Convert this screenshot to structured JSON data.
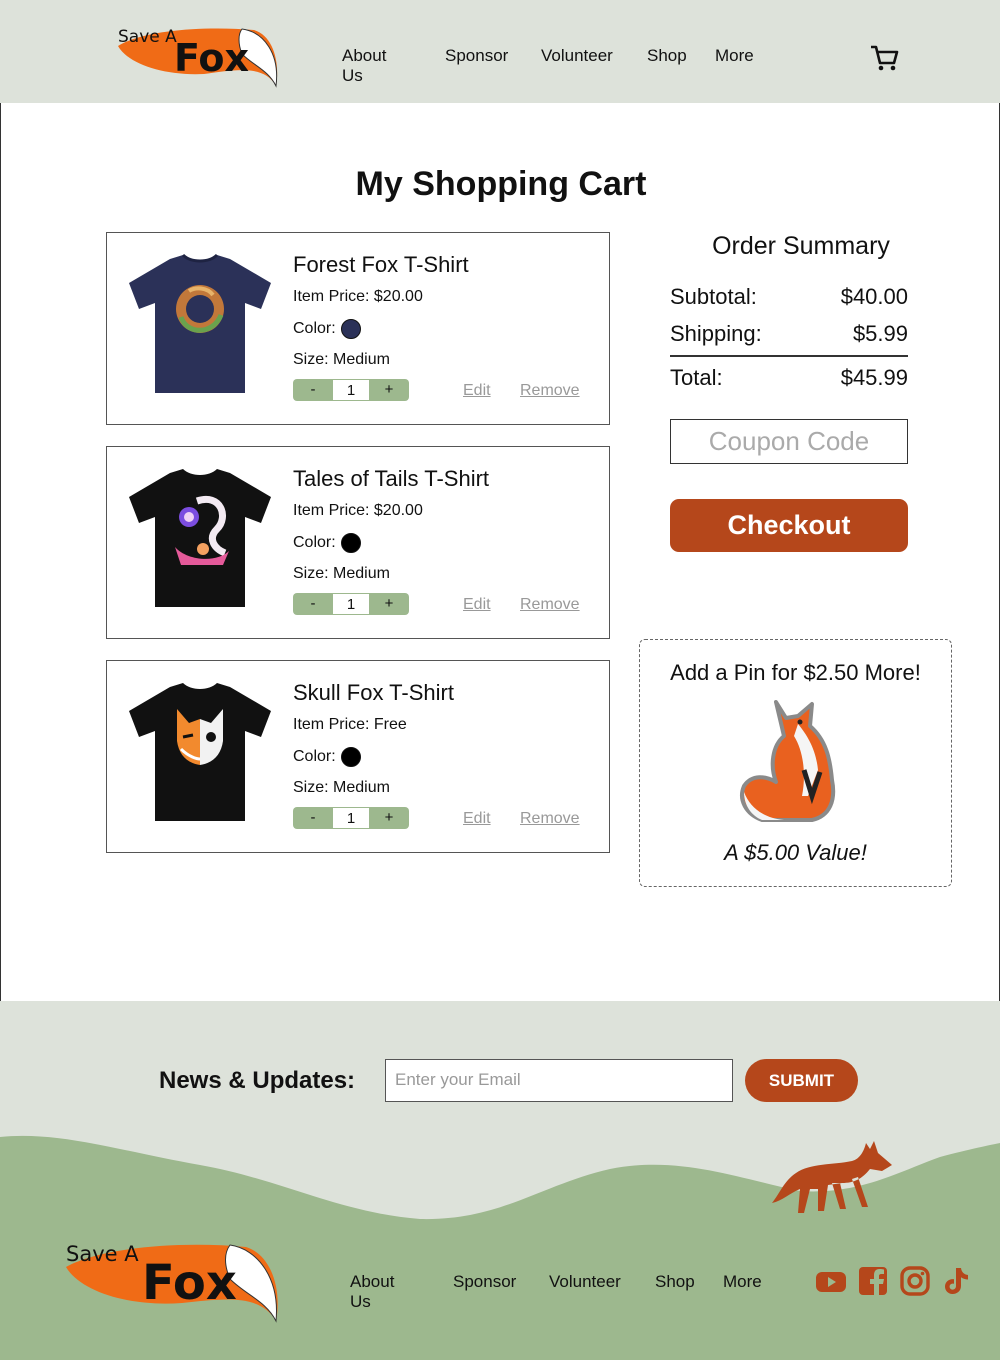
{
  "brand": {
    "logo_top": "Save A",
    "logo_main": "Fox",
    "colors": {
      "orange": "#f06b16",
      "rust": "#b5471b",
      "sage": "#9db88e",
      "mist": "#dde2da"
    }
  },
  "header": {
    "nav": [
      "About Us",
      "Sponsor",
      "Volunteer",
      "Shop",
      "More"
    ],
    "cart_icon": "shopping-cart-icon"
  },
  "page": {
    "title": "My Shopping Cart"
  },
  "cart": {
    "items": [
      {
        "name": "Forest Fox T-Shirt",
        "price": "Item Price: $20.00",
        "color_label": "Color:",
        "color": "#2b3158",
        "size": "Size: Medium",
        "quantity": "1",
        "minus": "-",
        "plus": "+",
        "edit": "Edit",
        "remove": "Remove"
      },
      {
        "name": "Tales of Tails T-Shirt",
        "price": "Item Price: $20.00",
        "color_label": "Color:",
        "color": "#000000",
        "size": "Size: Medium",
        "quantity": "1",
        "minus": "-",
        "plus": "+",
        "edit": "Edit",
        "remove": "Remove"
      },
      {
        "name": "Skull Fox T-Shirt",
        "price": "Item Price: Free",
        "color_label": "Color:",
        "color": "#000000",
        "size": "Size: Medium",
        "quantity": "1",
        "minus": "-",
        "plus": "+",
        "edit": "Edit",
        "remove": "Remove"
      }
    ]
  },
  "summary": {
    "title": "Order Summary",
    "subtotal_label": "Subtotal:",
    "subtotal": "$40.00",
    "shipping_label": "Shipping:",
    "shipping": "$5.99",
    "total_label": "Total:",
    "total": "$45.99",
    "coupon_placeholder": "Coupon Code",
    "checkout": "Checkout"
  },
  "promo": {
    "title": "Add a Pin for $2.50 More!",
    "value": "A $5.00 Value!"
  },
  "footer": {
    "news_label": "News & Updates:",
    "email_placeholder": "Enter your Email",
    "submit": "SUBMIT",
    "nav": [
      "About Us",
      "Sponsor",
      "Volunteer",
      "Shop",
      "More"
    ],
    "social": [
      "youtube-icon",
      "facebook-icon",
      "instagram-icon",
      "tiktok-icon"
    ]
  }
}
